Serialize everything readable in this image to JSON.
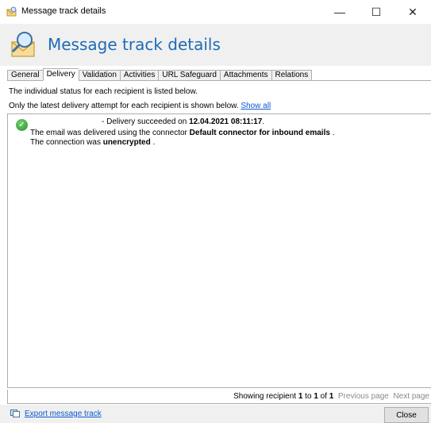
{
  "window": {
    "title": "Message track details",
    "minimize_glyph": "—",
    "maximize_glyph": "☐",
    "close_glyph": "✕"
  },
  "header": {
    "heading": "Message track details"
  },
  "tabs": [
    {
      "label": "General"
    },
    {
      "label": "Delivery",
      "active": true
    },
    {
      "label": "Validation"
    },
    {
      "label": "Activities"
    },
    {
      "label": "URL Safeguard"
    },
    {
      "label": "Attachments"
    },
    {
      "label": "Relations"
    }
  ],
  "delivery": {
    "info_line1": "The individual status for each recipient is listed below.",
    "info_line2": "Only the latest delivery attempt for each recipient is shown below.",
    "show_all_link": "Show all",
    "entry": {
      "status_icon": "check-success-icon",
      "line1_prefix": "- Delivery succeeded on ",
      "line1_date": "12.04.2021 08:11:17",
      "line1_suffix": ".",
      "line2_prefix": "The email was delivered  using the connector ",
      "line2_connector": "Default connector for inbound emails",
      "line2_suffix": " .",
      "line3_prefix": "The connection was ",
      "line3_state": "unencrypted",
      "line3_suffix": " ."
    }
  },
  "pager": {
    "prefix": "Showing recipient ",
    "from": "1",
    "to_word": " to ",
    "to": "1",
    "of_word": " of ",
    "total": "1",
    "previous": "Previous page",
    "next": "Next page"
  },
  "footer": {
    "export_link": "Export message track",
    "close_button": "Close"
  },
  "colors": {
    "accent": "#1e6bb8",
    "link": "#0b57d0",
    "success": "#2a8f2a"
  }
}
